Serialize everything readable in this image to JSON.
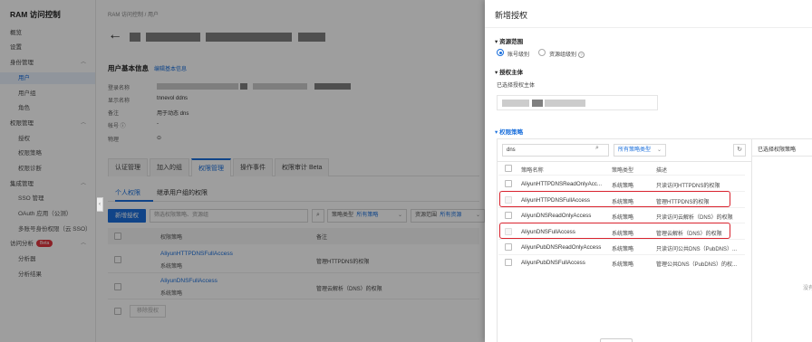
{
  "sidebar": {
    "title": "RAM 访问控制",
    "items": [
      {
        "label": "概览",
        "level": 1
      },
      {
        "label": "设置",
        "level": 1
      },
      {
        "label": "身份管理",
        "level": 1,
        "expandable": true
      },
      {
        "label": "用户",
        "level": 2,
        "active": true
      },
      {
        "label": "用户组",
        "level": 2
      },
      {
        "label": "角色",
        "level": 2
      },
      {
        "label": "权限管理",
        "level": 1,
        "expandable": true
      },
      {
        "label": "授权",
        "level": 2
      },
      {
        "label": "权限策略",
        "level": 2
      },
      {
        "label": "权限诊断",
        "level": 2
      },
      {
        "label": "集成管理",
        "level": 1,
        "expandable": true
      },
      {
        "label": "SSO 管理",
        "level": 2
      },
      {
        "label": "OAuth 应用（公测）",
        "level": 2
      },
      {
        "label": "多账号身份权限（云 SSO）",
        "level": 2
      },
      {
        "label": "访问分析",
        "level": 1,
        "expandable": true,
        "badge": "Beta"
      },
      {
        "label": "分析器",
        "level": 2
      },
      {
        "label": "分析结果",
        "level": 2
      }
    ]
  },
  "main": {
    "breadcrumb": "RAM 访问控制   /   用户",
    "basic_info": {
      "title": "用户基本信息",
      "edit_link": "编辑基本信息",
      "fields": [
        {
          "label": "登录名称",
          "value": ""
        },
        {
          "label": "显示名称",
          "value": "tnnevol ddns"
        },
        {
          "label": "备注",
          "value": "用于动态 dns"
        },
        {
          "label": "帐号 ⓘ",
          "value": "-"
        },
        {
          "label": "物理",
          "value": "⊙"
        }
      ]
    },
    "tabs": [
      "认证管理",
      "加入的组",
      "权限管理",
      "操作事件",
      "权限审计 Beta"
    ],
    "active_tab": 2,
    "subtabs": [
      "个人权限",
      "继承用户组的权限"
    ],
    "toolbar": {
      "new_grant": "新增授权",
      "search_placeholder": "筛选权限策略、资源组",
      "policy_type_label": "策略类型",
      "policy_type_value": "所有策略",
      "resource_scope_label": "资源范围",
      "resource_scope_value": "所有资源"
    },
    "table": {
      "headers": [
        "权限策略",
        "备注"
      ],
      "rows": [
        {
          "name": "AliyunHTTPDNSFullAccess",
          "type": "系统策略",
          "note": "管理HTTPDNS的权限"
        },
        {
          "name": "AliyunDNSFullAccess",
          "type": "系统策略",
          "note": "管理云解析（DNS）的权限"
        }
      ]
    },
    "remove_button": "移除授权"
  },
  "drawer": {
    "title": "新增授权",
    "scope_section": "资源范围",
    "scope_options": [
      "账号级别",
      "资源组级别"
    ],
    "scope_selected": 0,
    "principal_section": "授权主体",
    "principal_label": "已选择授权主体",
    "policy_section": "权限策略",
    "search_value": "dns",
    "type_filter": "所有策略类型",
    "selected_panel_title": "已选择权限策略",
    "selected_empty": "没有",
    "headers": [
      "策略名称",
      "策略类型",
      "描述"
    ],
    "policies": [
      {
        "name": "AliyunHTTPDNSReadOnlyAcc...",
        "type": "系统策略",
        "desc": "只读访问HTTPDNS的权限",
        "disabled": false
      },
      {
        "name": "AliyunHTTPDNSFullAccess",
        "type": "系统策略",
        "desc": "管理HTTPDNS的权限",
        "disabled": true,
        "highlight": true
      },
      {
        "name": "AliyunDNSReadOnlyAccess",
        "type": "系统策略",
        "desc": "只读访问云解析（DNS）的权限",
        "disabled": false
      },
      {
        "name": "AliyunDNSFullAccess",
        "type": "系统策略",
        "desc": "管理云解析（DNS）的权限",
        "disabled": true,
        "highlight": true
      },
      {
        "name": "AliyunPubDNSReadOnlyAccess",
        "type": "系统策略",
        "desc": "只读访问公共DNS（PubDNS）...",
        "disabled": false
      },
      {
        "name": "AliyunPubDNSFullAccess",
        "type": "系统策略",
        "desc": "管理公共DNS（PubDNS）的权...",
        "disabled": false
      }
    ]
  },
  "colors": {
    "accent": "#1a6fdc",
    "highlight": "#d9232e",
    "badge": "#e0363f"
  }
}
